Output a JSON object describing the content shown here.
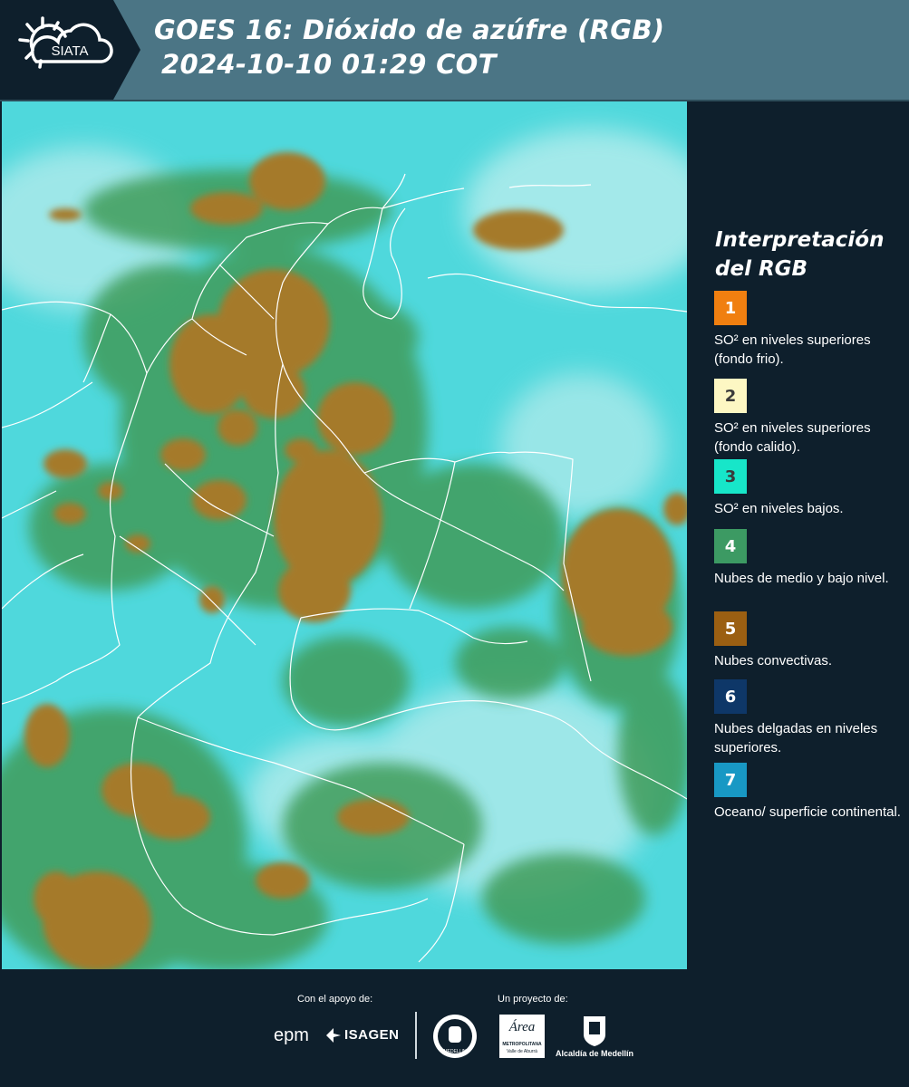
{
  "header": {
    "logo_text": "SIATA",
    "title_line1": "GOES 16: Dióxido de azúfre (RGB)",
    "title_line2": "2024-10-10 01:29 COT"
  },
  "map": {
    "icon": "satellite-rgb-composite",
    "colors": {
      "background": "#4fd8dc",
      "cloud_green": "#3f9c5a",
      "convective": "#a57a2c",
      "border": "#ffffff"
    }
  },
  "legend": {
    "title": "Interpretación del RGB",
    "items": [
      {
        "number": "1",
        "label": "SO² en niveles superiores (fondo frio).",
        "color": "#f07f10",
        "text_color": "#ffffff"
      },
      {
        "number": "2",
        "label": "SO² en niveles superiores (fondo calido).",
        "color": "#fdf7c3",
        "text_color": "#3a3a3a"
      },
      {
        "number": "3",
        "label": "SO² en niveles bajos.",
        "color": "#17e6c9",
        "text_color": "#3a3a3a"
      },
      {
        "number": "4",
        "label": "Nubes de medio y bajo nivel.",
        "color": "#3c9a63",
        "text_color": "#ffffff"
      },
      {
        "number": "5",
        "label": "Nubes convectivas.",
        "color": "#9b5f12",
        "text_color": "#ffffff"
      },
      {
        "number": "6",
        "label": "Nubes delgadas en niveles superiores.",
        "color": "#0e3768",
        "text_color": "#ffffff"
      },
      {
        "number": "7",
        "label": "Oceano/ superficie continental.",
        "color": "#1898c4",
        "text_color": "#ffffff"
      }
    ]
  },
  "footer": {
    "support_label": "Con el apoyo de:",
    "project_label": "Un proyecto de:",
    "sponsors": [
      "epm",
      "ISAGEN"
    ],
    "partners": [
      "Área Metropolitana Valle de Aburrá",
      "Alcaldía de Medellín"
    ],
    "area_text": "Área",
    "area_caption": "METROPOLITANA",
    "area_subcaption": "Valle de Aburrá",
    "alcaldia_caption": "Alcaldía de Medellín",
    "medellin_text": "MEDELLIN"
  }
}
